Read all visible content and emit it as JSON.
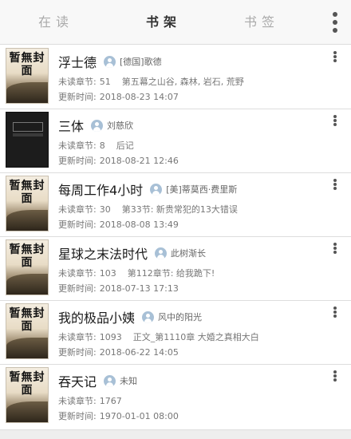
{
  "tabs": [
    {
      "label": "在读",
      "active": false
    },
    {
      "label": "书架",
      "active": true
    },
    {
      "label": "书签",
      "active": false
    }
  ],
  "top_menu_icon": "more-vertical-icon",
  "labels": {
    "unread": "未读章节:",
    "updated": "更新时间:"
  },
  "books": [
    {
      "title": "浮士德",
      "author": "[德国]歌德",
      "unread_count": "51",
      "latest_chapter": "第五幕之山谷, 森林, 岩石, 荒野",
      "updated": "2018-08-23 14:07",
      "cover": "default",
      "cover_text": "暂無封面"
    },
    {
      "title": "三体",
      "author": "刘慈欣",
      "unread_count": "8",
      "latest_chapter": "后记",
      "updated": "2018-08-21 12:46",
      "cover": "dark",
      "cover_text": ""
    },
    {
      "title": "每周工作4小时",
      "author": "[美]蒂莫西·费里斯",
      "unread_count": "30",
      "latest_chapter": "第33节: 新贵常犯的13大错误",
      "updated": "2018-08-08 13:49",
      "cover": "default",
      "cover_text": "暂無封面"
    },
    {
      "title": "星球之末法时代",
      "author": "此树渐长",
      "unread_count": "103",
      "latest_chapter": "第112章节: 给我跪下!",
      "updated": "2018-07-13 17:13",
      "cover": "default",
      "cover_text": "暂無封面"
    },
    {
      "title": "我的极品小姨",
      "author": "风中的阳光",
      "unread_count": "1093",
      "latest_chapter": "正文_第1110章 大婚之真相大白",
      "updated": "2018-06-22 14:05",
      "cover": "default",
      "cover_text": "暂無封面"
    },
    {
      "title": "吞天记",
      "author": "未知",
      "unread_count": "1767",
      "latest_chapter": "",
      "updated": "1970-01-01 08:00",
      "cover": "default",
      "cover_text": "暂無封面"
    }
  ]
}
